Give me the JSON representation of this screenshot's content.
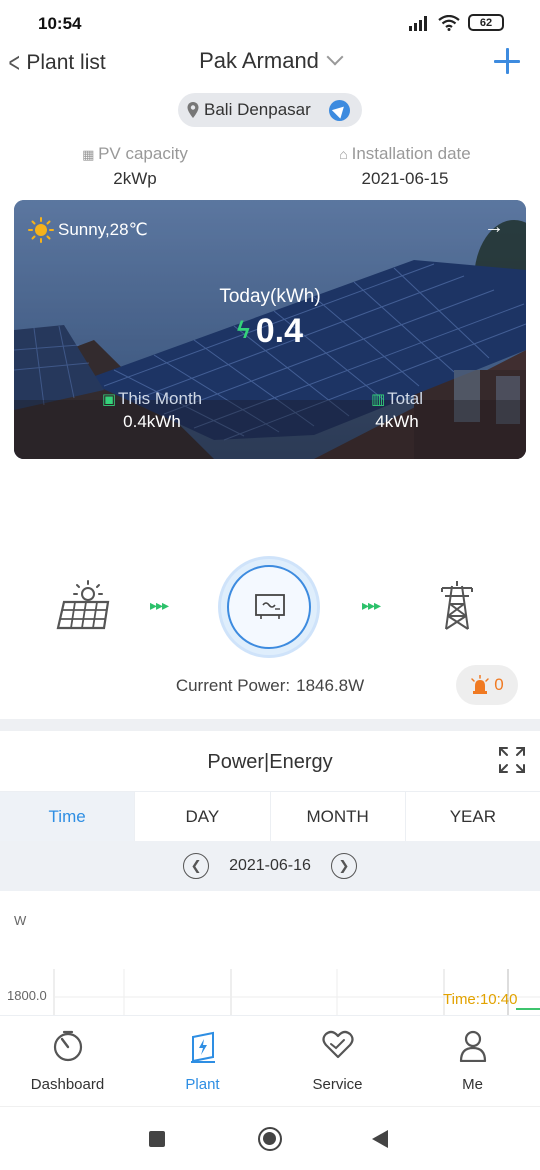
{
  "status_bar": {
    "time": "10:54",
    "battery": "62"
  },
  "header": {
    "back_label": "Plant list",
    "title": "Pak Armand"
  },
  "location": {
    "text": "Bali Denpasar"
  },
  "meta": {
    "pv_capacity_label": "PV capacity",
    "pv_capacity_value": "2kWp",
    "install_label": "Installation date",
    "install_value": "2021-06-15"
  },
  "hero": {
    "weather": "Sunny,28℃",
    "today_label": "Today(kWh)",
    "today_value": "0.4",
    "month_label": "This Month",
    "month_value": "0.4kWh",
    "total_label": "Total",
    "total_value": "4kWh"
  },
  "flow": {
    "current_power_label": "Current Power:",
    "current_power_value": "1846.8W",
    "alarm_count": "0"
  },
  "section": {
    "title": "Power|Energy"
  },
  "tabs": [
    {
      "label": "Time",
      "active": true
    },
    {
      "label": "DAY",
      "active": false
    },
    {
      "label": "MONTH",
      "active": false
    },
    {
      "label": "YEAR",
      "active": false
    }
  ],
  "date_selector": {
    "date": "2021-06-16"
  },
  "chart": {
    "ylabel": "W",
    "ytick": "1800.0",
    "tooltip_time": "Time:10:40"
  },
  "bottom_nav": [
    {
      "label": "Dashboard",
      "icon": "gauge-icon",
      "active": false
    },
    {
      "label": "Plant",
      "icon": "plant-icon",
      "active": true
    },
    {
      "label": "Service",
      "icon": "heart-icon",
      "active": false
    },
    {
      "label": "Me",
      "icon": "person-icon",
      "active": false
    }
  ],
  "colors": {
    "accent": "#3d8bdf",
    "green": "#2cc16a",
    "alarm": "#f07a22"
  }
}
